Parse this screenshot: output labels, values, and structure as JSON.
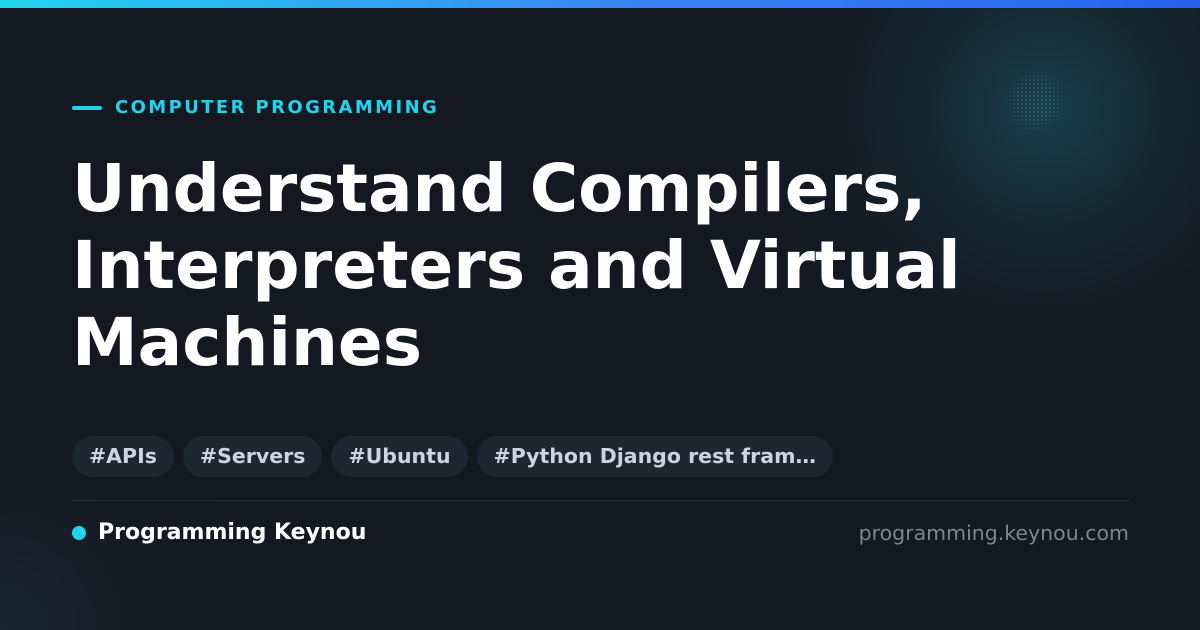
{
  "colors": {
    "background": "#141821",
    "accent": "#22d3ee",
    "top_bar_start": "#22d3ee",
    "top_bar_end": "#2563eb",
    "title": "#ffffff",
    "tag_background": "#1d2631",
    "tag_text": "#cbd5e1",
    "domain_text": "#7b8594"
  },
  "category": {
    "label": "COMPUTER PROGRAMMING"
  },
  "title": {
    "lines": [
      "Understand Compilers,",
      "Interpreters and Virtual",
      "Machines"
    ]
  },
  "tags": [
    "#APIs",
    "#Servers",
    "#Ubuntu",
    "#Python Django rest fram…"
  ],
  "footer": {
    "brand_name": "Programming Keynou",
    "domain": "programming.keynou.com"
  }
}
